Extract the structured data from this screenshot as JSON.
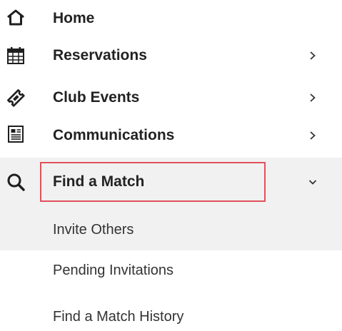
{
  "nav": {
    "items": [
      {
        "id": "home",
        "label": "Home",
        "icon": "home-icon"
      },
      {
        "id": "reservations",
        "label": "Reservations",
        "icon": "calendar-icon",
        "chevron": "chevron-right-icon"
      },
      {
        "id": "club_events",
        "label": "Club Events",
        "icon": "ticket-icon",
        "chevron": "chevron-right-icon"
      },
      {
        "id": "communications",
        "label": "Communications",
        "icon": "newspaper-icon",
        "chevron": "chevron-right-icon"
      },
      {
        "id": "find_a_match",
        "label": "Find a Match",
        "icon": "search-icon",
        "chevron": "chevron-down-icon",
        "expanded": true,
        "highlight_color": "#e0515c"
      }
    ],
    "submenu": [
      {
        "label": "Invite Others"
      },
      {
        "label": "Pending Invitations"
      },
      {
        "label": "Find a Match History"
      }
    ]
  },
  "colors": {
    "text": "#222222",
    "expanded_background": "#f1f1f1",
    "highlight_border": "#e0515c"
  }
}
